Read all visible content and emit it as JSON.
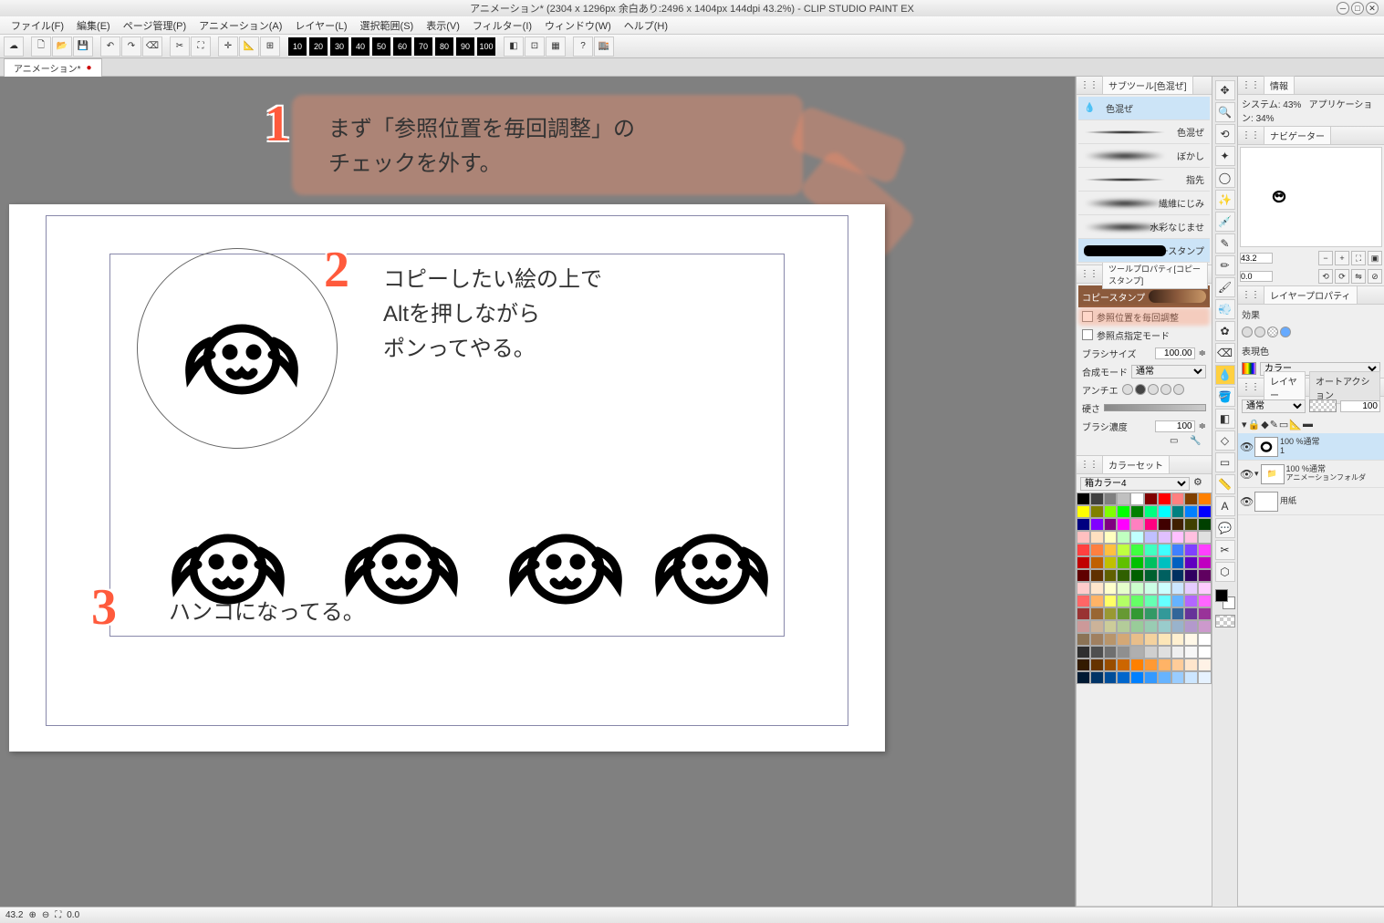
{
  "title": "アニメーション* (2304 x 1296px 余白あり:2496 x 1404px 144dpi 43.2%)  - CLIP STUDIO PAINT EX",
  "menu": [
    "ファイル(F)",
    "編集(E)",
    "ページ管理(P)",
    "アニメーション(A)",
    "レイヤー(L)",
    "選択範囲(S)",
    "表示(V)",
    "フィルター(I)",
    "ウィンドウ(W)",
    "ヘルプ(H)"
  ],
  "tabName": "アニメーション*",
  "toolbarNums": [
    "10",
    "20",
    "30",
    "40",
    "50",
    "60",
    "70",
    "80",
    "90",
    "100"
  ],
  "annotations": {
    "n1": "1",
    "t1a": "まず「参照位置を毎回調整」の",
    "t1b": "チェックを外す。",
    "n2": "2",
    "t2a": "コピーしたい絵の上で",
    "t2b": "Altを押しながら",
    "t2c": "ポンってやる。",
    "n3": "3",
    "t3": "ハンコになってる。"
  },
  "subtool": {
    "tabLabel": "サブツール[色混ぜ]",
    "groupLabel": "色混ぜ",
    "brushes": [
      "色混ぜ",
      "ぼかし",
      "指先",
      "繊維にじみ",
      "水彩なじませ",
      "コピースタンプ"
    ]
  },
  "toolProperty": {
    "tabLabel": "ツールプロパティ[コピースタンプ]",
    "headerLabel": "コピースタンプ",
    "adjustRef": "参照位置を毎回調整",
    "refPoint": "参照点指定モード",
    "brushSize": "ブラシサイズ",
    "brushSizeVal": "100.00",
    "blendMode": "合成モード",
    "blendModeVal": "通常",
    "antiAlias": "アンチエ",
    "hardness": "硬さ",
    "density": "ブラシ濃度",
    "densityVal": "100"
  },
  "colorSet": {
    "tabLabel": "カラーセット",
    "paletteName": "箱カラー4"
  },
  "info": {
    "tabLabel": "情報",
    "systemLabel": "システム:",
    "systemVal": "43%",
    "appLabel": "アプリケーション:",
    "appVal": "34%"
  },
  "navigator": {
    "tabLabel": "ナビゲーター",
    "zoom": "43.2",
    "angle": "0.0"
  },
  "layerProp": {
    "tabLabel": "レイヤープロパティ",
    "effect": "効果",
    "renderColor": "表現色",
    "renderVal": "カラー"
  },
  "layers": {
    "tabLabel": "レイヤー",
    "autoAction": "オートアクション",
    "blendVal": "通常",
    "opacity": "100",
    "items": [
      {
        "name": "100 %通常",
        "sub": "1"
      },
      {
        "name": "100 %通常",
        "sub": "アニメーションフォルダ"
      },
      {
        "name": "",
        "sub": "用紙"
      }
    ]
  },
  "status": {
    "zoom": "43.2",
    "angle": "0.0"
  },
  "colorPalette": [
    "#000000",
    "#404040",
    "#808080",
    "#c0c0c0",
    "#ffffff",
    "#800000",
    "#ff0000",
    "#ff8080",
    "#804000",
    "#ff8000",
    "#ffff00",
    "#808000",
    "#80ff00",
    "#00ff00",
    "#008000",
    "#00ff80",
    "#00ffff",
    "#008080",
    "#0080ff",
    "#0000ff",
    "#000080",
    "#8000ff",
    "#800080",
    "#ff00ff",
    "#ff80c0",
    "#ff0080",
    "#400000",
    "#402000",
    "#404000",
    "#004000",
    "#ffc0c0",
    "#ffe0c0",
    "#ffffc0",
    "#c0ffc0",
    "#c0ffff",
    "#c0c0ff",
    "#e0c0ff",
    "#ffc0ff",
    "#ffc0e0",
    "#e0e0e0",
    "#ff4040",
    "#ff8040",
    "#ffc040",
    "#c0ff40",
    "#40ff40",
    "#40ffc0",
    "#40ffff",
    "#4080ff",
    "#8040ff",
    "#ff40ff",
    "#c00000",
    "#c06000",
    "#c0c000",
    "#60c000",
    "#00c000",
    "#00c060",
    "#00c0c0",
    "#0060c0",
    "#6000c0",
    "#c000c0",
    "#600000",
    "#603000",
    "#606000",
    "#306000",
    "#006000",
    "#006030",
    "#006060",
    "#003060",
    "#300060",
    "#600060",
    "#ffcccc",
    "#ffe6cc",
    "#ffffcc",
    "#e6ffcc",
    "#ccffcc",
    "#ccffe6",
    "#ccffff",
    "#cce6ff",
    "#e6ccff",
    "#ffccff",
    "#ff6666",
    "#ffb366",
    "#ffff66",
    "#b3ff66",
    "#66ff66",
    "#66ffb3",
    "#66ffff",
    "#66b3ff",
    "#b366ff",
    "#ff66ff",
    "#993333",
    "#996633",
    "#999933",
    "#669933",
    "#339933",
    "#339966",
    "#339999",
    "#336699",
    "#663399",
    "#993399",
    "#cc9999",
    "#ccb399",
    "#cccc99",
    "#b3cc99",
    "#99cc99",
    "#99ccb3",
    "#99cccc",
    "#99b3cc",
    "#b399cc",
    "#cc99cc",
    "#8b7355",
    "#a08060",
    "#b8956b",
    "#d4a876",
    "#e8be8a",
    "#f4d29e",
    "#fce6b8",
    "#fff0d0",
    "#fff8e8",
    "#ffffff",
    "#2f2f2f",
    "#4f4f4f",
    "#6f6f6f",
    "#8f8f8f",
    "#afafaf",
    "#cfcfcf",
    "#dfdfdf",
    "#efefef",
    "#f7f7f7",
    "#ffffff",
    "#331a00",
    "#663300",
    "#994d00",
    "#cc6600",
    "#ff8000",
    "#ff9933",
    "#ffb366",
    "#ffcc99",
    "#ffe6cc",
    "#fff2e6",
    "#001a33",
    "#003366",
    "#004d99",
    "#0066cc",
    "#0080ff",
    "#3399ff",
    "#66b3ff",
    "#99ccff",
    "#cce6ff",
    "#e6f2ff"
  ]
}
